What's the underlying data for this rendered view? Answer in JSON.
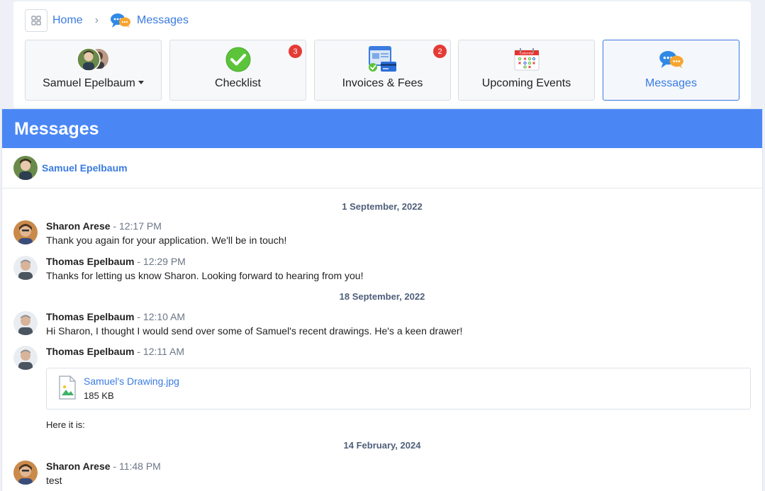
{
  "breadcrumb": {
    "home": "Home",
    "current": "Messages"
  },
  "tiles": [
    {
      "label": "Samuel Epelbaum",
      "icon": "student-avatars-icon",
      "dropdown": true
    },
    {
      "label": "Checklist",
      "icon": "checkmark-icon",
      "badge": "3"
    },
    {
      "label": "Invoices & Fees",
      "icon": "invoice-icon",
      "badge": "2"
    },
    {
      "label": "Upcoming Events",
      "icon": "calendar-icon",
      "calendar_caption": "Calendar"
    },
    {
      "label": "Messages",
      "icon": "chat-bubbles-icon",
      "active": true
    }
  ],
  "panel": {
    "title": "Messages",
    "student_name": "Samuel Epelbaum",
    "dates": [
      "1 September, 2022",
      "18 September, 2022",
      "14 February, 2024"
    ],
    "messages": [
      {
        "author": "Sharon Arese",
        "time": "- 12:17 PM",
        "text": "Thank you again for your application. We'll be in touch!"
      },
      {
        "author": "Thomas Epelbaum",
        "time": "- 12:29 PM",
        "text": "Thanks for letting us know Sharon. Looking forward to hearing from you!"
      },
      {
        "author": "Thomas Epelbaum",
        "time": "- 12:10 AM",
        "text": "Hi Sharon, I thought I would send over some of Samuel's recent drawings. He's a keen drawer!"
      },
      {
        "author": "Thomas Epelbaum",
        "time": "- 12:11 AM",
        "text": ""
      },
      {
        "author": "Sharon Arese",
        "time": "- 11:48 PM",
        "text": "test"
      }
    ],
    "attachment": {
      "name": "Samuel's Drawing.jpg",
      "size": "185 KB",
      "icon": "image-file-icon"
    },
    "after_attachment_text": "Here it is:"
  },
  "colors": {
    "accent": "#3a7be0",
    "header_blue": "#4a87f5",
    "badge_red": "#e53b35",
    "check_green": "#5cc43a"
  }
}
